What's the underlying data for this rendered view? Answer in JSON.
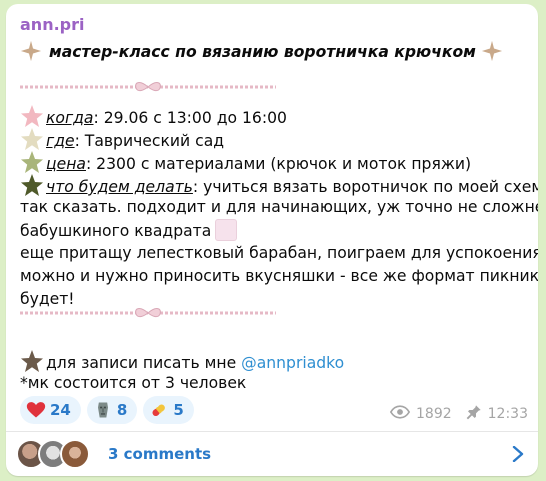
{
  "channel": {
    "author": "ann.pri"
  },
  "post": {
    "title": "мастер-класс по вязанию воротничка крючком",
    "when_label": "когда",
    "when_value": ": 29.06 с 13:00 до 16:00",
    "where_label": "где",
    "where_value": ": Таврический сад",
    "price_label": "цена",
    "price_value": ": 2300 с материалами (крючок и моток пряжи)",
    "plan_label": "что будем делать",
    "plan_value_1": ": учиться вязать воротничок по моей схеме",
    "plan_line_2": "так сказать. подходит и для начинающих, уж точно не сложнее",
    "plan_line_3": "бабушкиного квадрата",
    "plan_line_4": "еще притащу лепестковый барабан, поиграем для успокоения.",
    "plan_line_5": "можно и нужно приносить вкусняшки - все же формат пикника",
    "plan_line_6": "будет!",
    "signup_text": "для записи писать мне ",
    "signup_mention": "@annpriadko",
    "min_people": "*мк состоится от 3 человек"
  },
  "star_colors": {
    "title": "#c9a98a",
    "when": "#f2b8c0",
    "where": "#e3dcc0",
    "price": "#a9b57a",
    "plan": "#4f5a2a",
    "signup": "#6b5a4a"
  },
  "reactions": [
    {
      "icon": "heart-icon",
      "count": "24"
    },
    {
      "icon": "moai-icon",
      "count": "8"
    },
    {
      "icon": "pill-icon",
      "count": "5"
    }
  ],
  "meta": {
    "views": "1892",
    "time": "12:33"
  },
  "comments": {
    "label": "3 comments"
  }
}
